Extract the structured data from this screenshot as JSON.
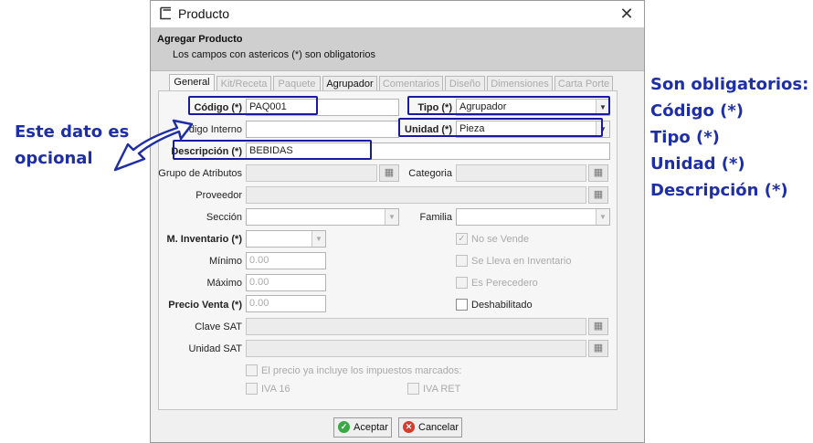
{
  "window": {
    "title": "Producto",
    "close_glyph": "✕",
    "icon": "app-icon"
  },
  "header": {
    "title": "Agregar Producto",
    "subtitle": "Los campos con astericos (*) son obligatorios"
  },
  "tabs": [
    "General",
    "Kit/Receta",
    "Paquete",
    "Agrupador",
    "Comentarios",
    "Diseño",
    "Dimensiones",
    "Carta Porte"
  ],
  "form": {
    "codigo": {
      "label": "Código (*)",
      "value": "PAQ001"
    },
    "codigo_interno": {
      "label": "Código Interno",
      "value": ""
    },
    "descripcion": {
      "label": "Descripción (*)",
      "value": "BEBIDAS"
    },
    "tipo": {
      "label": "Tipo (*)",
      "value": "Agrupador"
    },
    "unidad": {
      "label": "Unidad (*)",
      "value": "Pieza"
    },
    "grupo_atributos": {
      "label": "Grupo de Atributos"
    },
    "categoria": {
      "label": "Categoria"
    },
    "proveedor": {
      "label": "Proveedor"
    },
    "seccion": {
      "label": "Sección"
    },
    "familia": {
      "label": "Familia"
    },
    "m_inventario": {
      "label": "M. Inventario (*)"
    },
    "minimo": {
      "label": "Mínimo",
      "placeholder": "0.00"
    },
    "maximo": {
      "label": "Máximo",
      "placeholder": "0.00"
    },
    "precio_venta": {
      "label": "Precio Venta (*)",
      "placeholder": "0.00"
    },
    "clave_sat": {
      "label": "Clave SAT"
    },
    "unidad_sat": {
      "label": "Unidad SAT"
    },
    "checks": {
      "no_se_vende": {
        "label": "No se Vende",
        "checked": true,
        "enabled": false
      },
      "se_lleva_inventario": {
        "label": "Se Lleva en Inventario",
        "checked": false,
        "enabled": false
      },
      "es_perecedero": {
        "label": "Es Perecedero",
        "checked": false,
        "enabled": false
      },
      "deshabilitado": {
        "label": "Deshabilitado",
        "checked": false,
        "enabled": true
      },
      "precio_incluye": {
        "label": "El precio ya incluye los impuestos marcados:",
        "checked": false,
        "enabled": false
      },
      "iva16": {
        "label": "IVA 16",
        "checked": false,
        "enabled": false
      },
      "iva_ret": {
        "label": "IVA RET",
        "checked": false,
        "enabled": false
      }
    }
  },
  "buttons": {
    "accept": "Aceptar",
    "cancel": "Cancelar"
  },
  "annotations": {
    "left": [
      "Este dato es",
      "opcional"
    ],
    "right": [
      "Son obligatorios:",
      "Código (*)",
      "Tipo (*)",
      "Unidad (*)",
      "Descripción (*)"
    ]
  },
  "colors": {
    "annotation": "#1e2fa5",
    "highlight_box": "#1a1a9e",
    "accept_icon": "#3aa845",
    "cancel_icon": "#d83a2e"
  }
}
